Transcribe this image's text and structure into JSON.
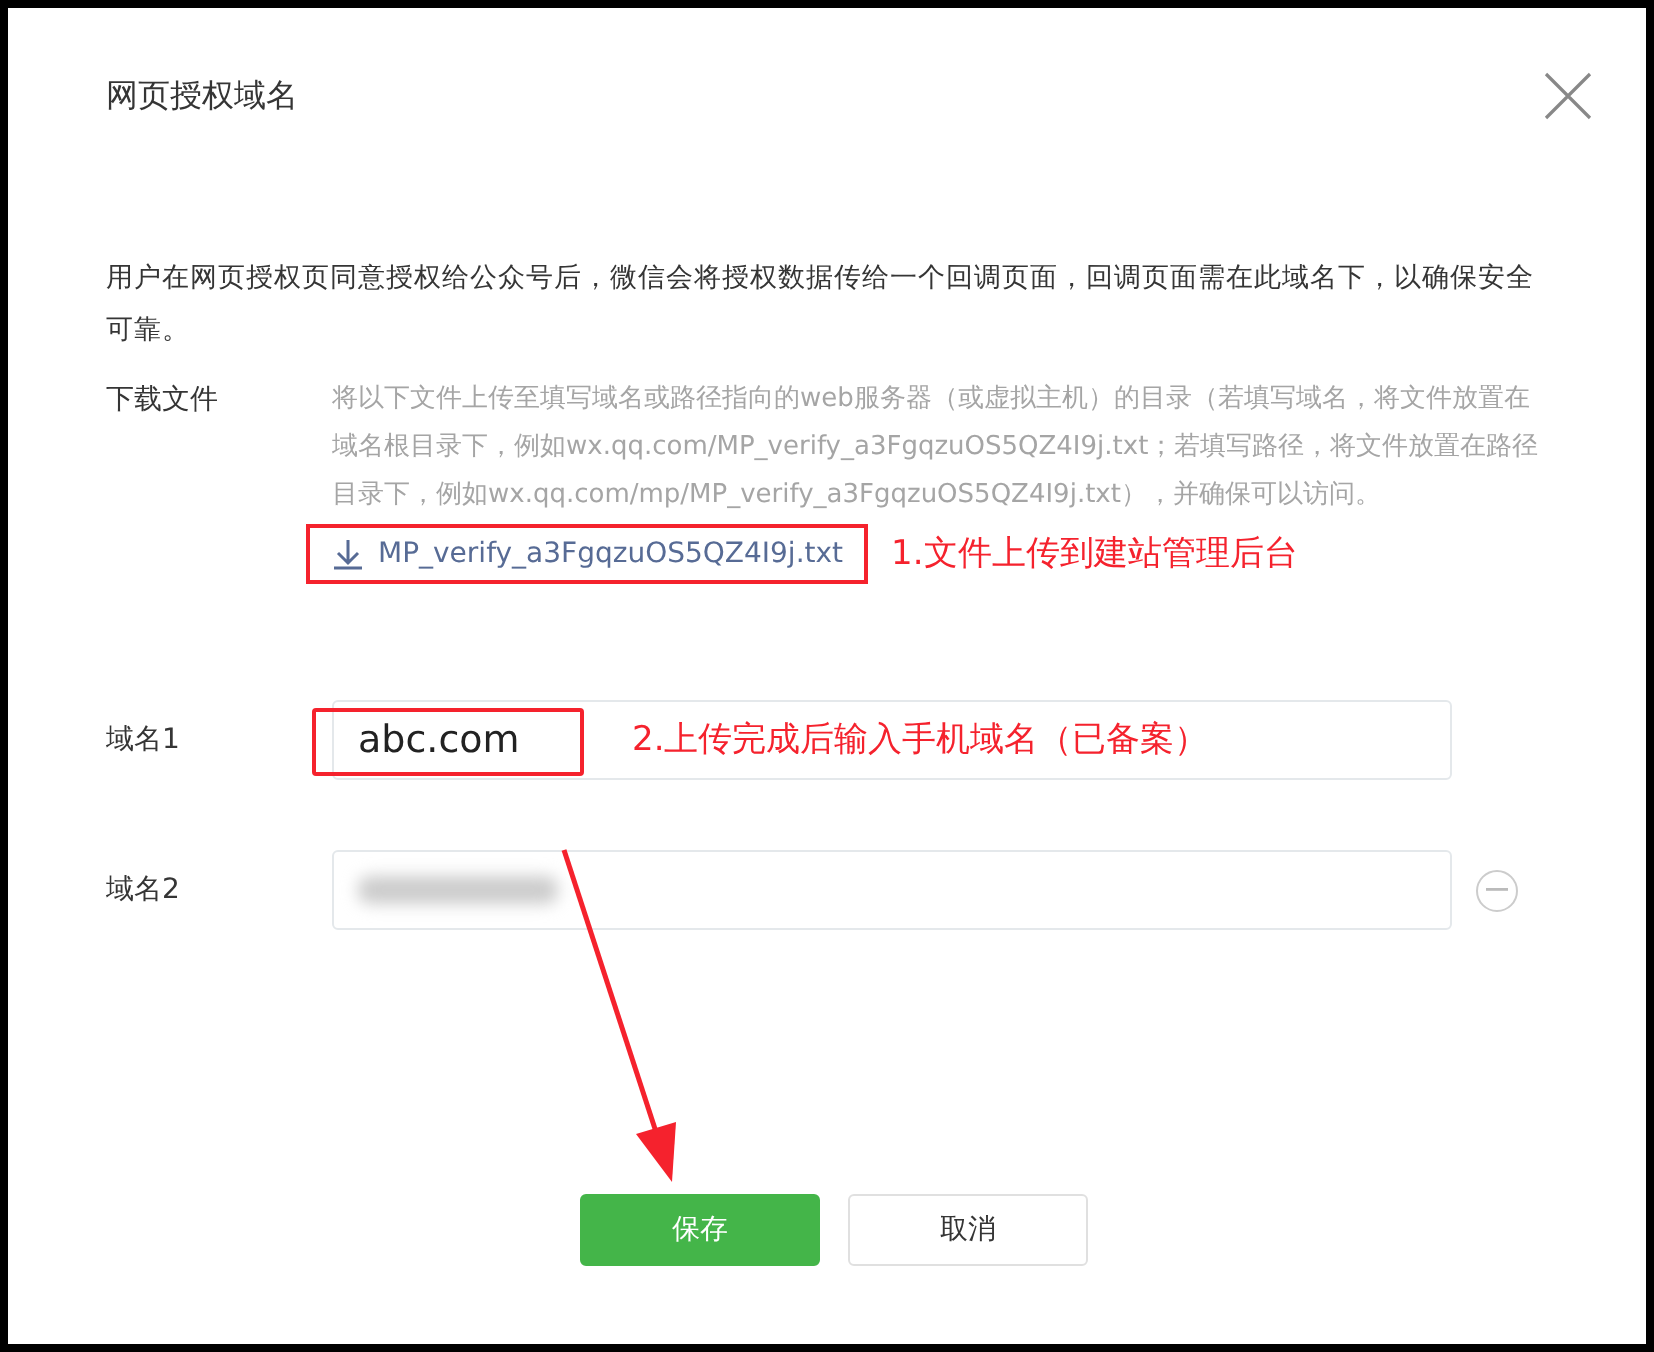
{
  "dialog": {
    "title": "网页授权域名"
  },
  "intro": "用户在网页授权页同意授权给公众号后，微信会将授权数据传给一个回调页面，回调页面需在此域名下，以确保安全可靠。",
  "download": {
    "label": "下载文件",
    "description": "将以下文件上传至填写域名或路径指向的web服务器（或虚拟主机）的目录（若填写域名，将文件放置在域名根目录下，例如wx.qq.com/MP_verify_a3FgqzuOS5QZ4I9j.txt；若填写路径，将文件放置在路径目录下，例如wx.qq.com/mp/MP_verify_a3FgqzuOS5QZ4I9j.txt），并确保可以访问。",
    "file": "MP_verify_a3FgqzuOS5QZ4I9j.txt"
  },
  "domains": [
    {
      "label": "域名1",
      "value": "abc.com",
      "blurred": false,
      "removable": false
    },
    {
      "label": "域名2",
      "blurred": true,
      "removable": true
    }
  ],
  "buttons": [
    {
      "label": "保存",
      "kind": "primary"
    },
    {
      "label": "取消",
      "kind": "default"
    }
  ],
  "annotations": [
    {
      "text": "1.文件上传到建站管理后台"
    },
    {
      "text": "2.上传完成后输入手机域名（已备案）"
    }
  ]
}
